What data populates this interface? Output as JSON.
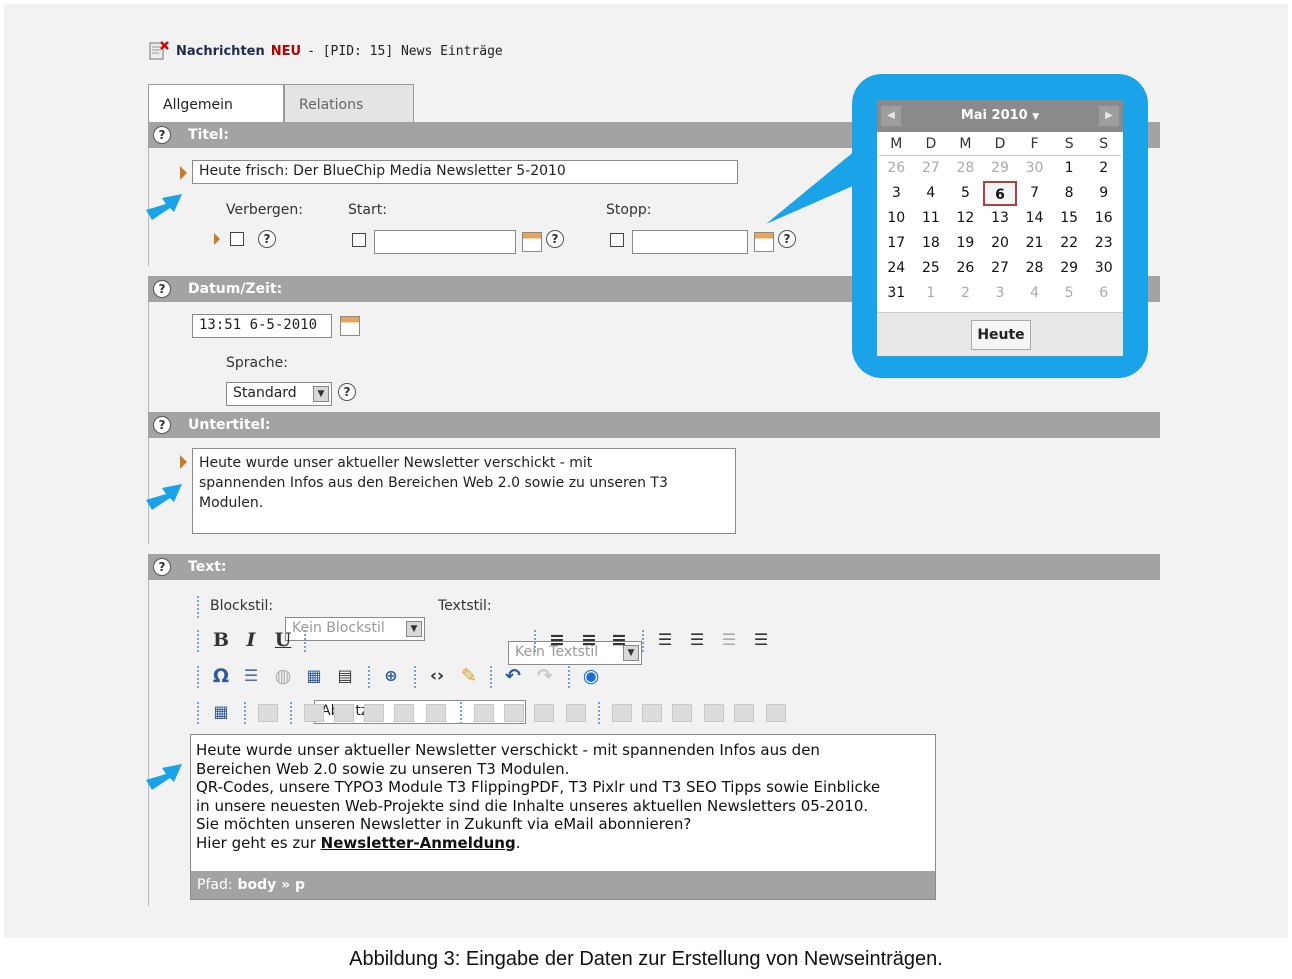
{
  "header": {
    "record_label": "Nachrichten",
    "new_label": "NEU",
    "pid_text": "- [PID: 15] News Einträge"
  },
  "tabs": [
    {
      "label": "Allgemein",
      "active": true
    },
    {
      "label": "Relations",
      "active": false
    }
  ],
  "sections": {
    "title": {
      "label": "Titel:",
      "value": "Heute frisch: Der BlueChip Media Newsletter 5-2010"
    },
    "visibility": {
      "hide_label": "Verbergen:",
      "start_label": "Start:",
      "stop_label": "Stopp:"
    },
    "datetime": {
      "label": "Datum/Zeit:",
      "value": "13:51 6-5-2010",
      "language_label": "Sprache:",
      "language_value": "Standard"
    },
    "subtitle": {
      "label": "Untertitel:",
      "lines": [
        "Heute wurde unser aktueller Newsletter verschickt - mit",
        "spannenden Infos aus den Bereichen Web 2.0 sowie zu unseren T3",
        "Modulen."
      ]
    },
    "text": {
      "label": "Text:",
      "blockstyle_label": "Blockstil:",
      "blockstyle_value": "Kein Blockstil",
      "textstyle_label": "Textstil:",
      "textstyle_value": "Kein Textstil",
      "paragraph_value": "Absatz",
      "body_lines": [
        "Heute wurde unser aktueller Newsletter verschickt - mit spannenden Infos aus den",
        "Bereichen Web 2.0 sowie zu unseren T3 Modulen.",
        "QR-Codes, unsere TYPO3 Module T3 FlippingPDF, T3 Pixlr und T3 SEO Tipps sowie Einblicke",
        "in unsere neuesten Web-Projekte sind die Inhalte unseres aktuellen Newsletters 05-2010.",
        "Sie möchten unseren Newsletter in Zukunft via eMail abonnieren?"
      ],
      "last_line_prefix": "Hier geht es zur ",
      "last_line_link": "Newsletter-Anmeldung",
      "last_line_suffix": ".",
      "path_label": "Pfad:",
      "path_body": "body",
      "path_sep": "»",
      "path_p": "p"
    }
  },
  "calendar": {
    "month_label": "Mai 2010",
    "weekdays": [
      "M",
      "D",
      "M",
      "D",
      "F",
      "S",
      "S"
    ],
    "weeks": [
      [
        "26",
        "27",
        "28",
        "29",
        "30",
        "1",
        "2"
      ],
      [
        "3",
        "4",
        "5",
        "6",
        "7",
        "8",
        "9"
      ],
      [
        "10",
        "11",
        "12",
        "13",
        "14",
        "15",
        "16"
      ],
      [
        "17",
        "18",
        "19",
        "20",
        "21",
        "22",
        "23"
      ],
      [
        "24",
        "25",
        "26",
        "27",
        "28",
        "29",
        "30"
      ],
      [
        "31",
        "1",
        "2",
        "3",
        "4",
        "5",
        "6"
      ]
    ],
    "selected_day": "6",
    "today_button": "Heute"
  },
  "help_symbol": "?",
  "caption": "Abbildung 3: Eingabe der Daten zur Erstellung von Newseinträgen.",
  "colors": {
    "accent_blue": "#1aa3e8",
    "section_grey": "#a3a3a3",
    "new_red": "#b00000"
  }
}
